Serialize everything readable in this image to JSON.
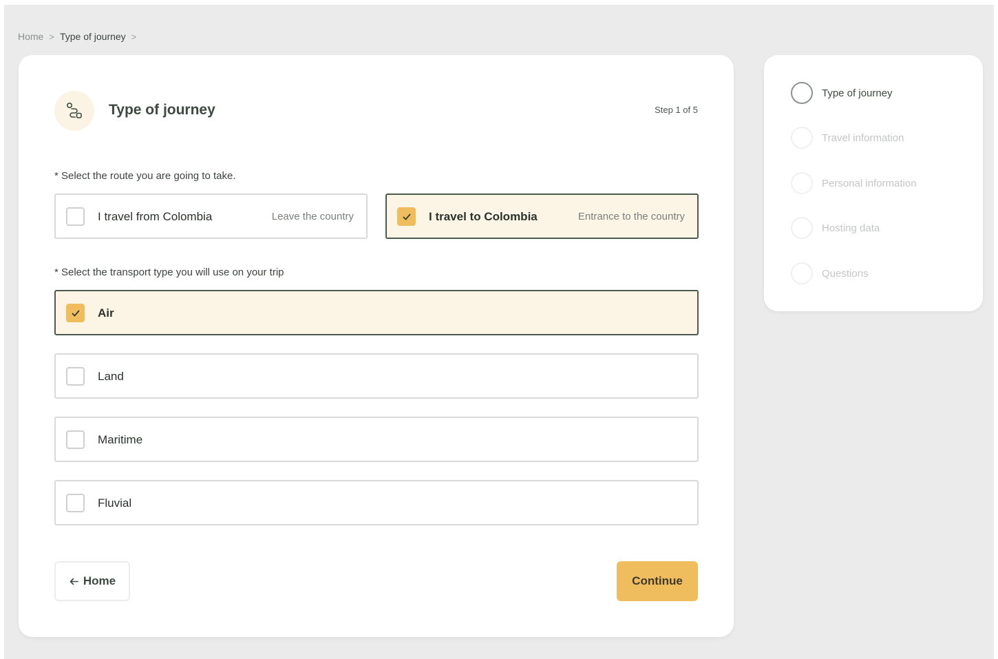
{
  "breadcrumb": {
    "home": "Home",
    "current": "Type of journey",
    "separator": ">"
  },
  "header": {
    "icon": "route-icon",
    "title": "Type of journey",
    "step": "Step 1 of 5"
  },
  "route": {
    "question": "* Select the route you are going to take.",
    "options": [
      {
        "label": "I travel from Colombia",
        "sub": "Leave the country",
        "selected": false
      },
      {
        "label": "I travel to Colombia",
        "sub": "Entrance to the country",
        "selected": true
      }
    ]
  },
  "transport": {
    "question": "* Select the transport type you will use on your trip",
    "options": [
      {
        "label": "Air",
        "selected": true
      },
      {
        "label": "Land",
        "selected": false
      },
      {
        "label": "Maritime",
        "selected": false
      },
      {
        "label": "Fluvial",
        "selected": false
      }
    ]
  },
  "buttons": {
    "home": "Home",
    "continue": "Continue"
  },
  "steps": [
    {
      "label": "Type of journey",
      "active": true
    },
    {
      "label": "Travel information",
      "active": false
    },
    {
      "label": "Personal information",
      "active": false
    },
    {
      "label": "Hosting data",
      "active": false
    },
    {
      "label": "Questions",
      "active": false
    }
  ],
  "colors": {
    "accent": "#f0bd5e",
    "selected_bg": "#fcf4e5",
    "selected_border": "#4a5a4e",
    "background": "#ebebeb"
  }
}
